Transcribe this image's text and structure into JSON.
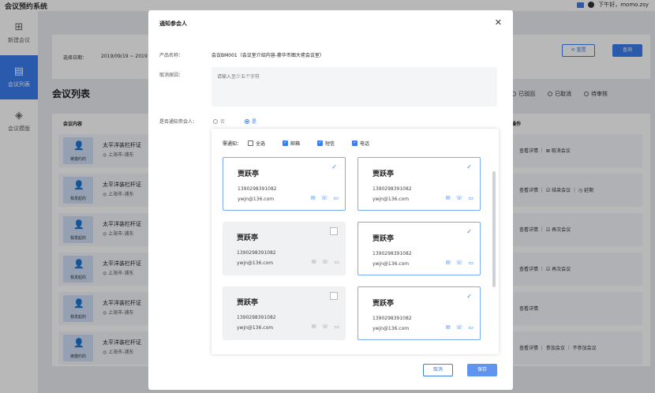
{
  "app": {
    "title": "会议预约系统",
    "greeting": "下午好，momo.zsy"
  },
  "sidebar": {
    "items": [
      {
        "label": "新建会议",
        "icon": "add-file-icon",
        "active": false
      },
      {
        "label": "会议列表",
        "icon": "list-icon",
        "active": true
      },
      {
        "label": "会议模版",
        "icon": "layers-icon",
        "active": false
      }
    ]
  },
  "filter": {
    "date_label": "选择日期：",
    "date_value": "2019/09/19 ~ 2019",
    "reset_label": "⟲ 重置",
    "query_label": "查询"
  },
  "list": {
    "title": "会议列表",
    "status_tabs": [
      "已驳回",
      "已取消",
      "待审核"
    ],
    "col_content": "会议内容",
    "col_action": "操作",
    "rows": [
      {
        "tag": "被邀约的",
        "title": "太平洋装栏杆证",
        "addr": "上海市-浦东",
        "actions": "查看详情 ｜ ⊠ 取消会议"
      },
      {
        "tag": "我发起的",
        "title": "太平洋装栏杆证",
        "addr": "上海市-浦东",
        "actions": "查看详情 ｜ ☑ 结束会议 ｜ ◷ 延期"
      },
      {
        "tag": "我发起的",
        "title": "太平洋装栏杆证",
        "addr": "上海市-浦东",
        "actions": "查看详情 ｜ ☑ 再次会议"
      },
      {
        "tag": "我发起的",
        "title": "太平洋装栏杆证",
        "addr": "上海市-浦东",
        "actions": "查看详情 ｜ ☑ 再次会议"
      },
      {
        "tag": "我发起的",
        "title": "太平洋装栏杆证",
        "addr": "上海市-浦东",
        "actions": "查看详情"
      },
      {
        "tag": "被邀约的",
        "title": "太平洋装栏杆证",
        "addr": "上海市-浦东",
        "actions": "查看详情 ｜ 参加会议 ｜ 不参加会议"
      }
    ]
  },
  "modal": {
    "title": "通知参会人",
    "product_label": "产品名称：",
    "product_value": "会议BM001（会议室介绍内容-豪华币图大佬会议室）",
    "reason_label": "取消原因：",
    "reason_placeholder": "请输入至少五个字符",
    "notify_label": "是否通知参会人：",
    "opt_no": "否",
    "opt_yes": "是",
    "channel_label": "需通知：",
    "channels": [
      {
        "label": "全选",
        "checked": false
      },
      {
        "label": "邮箱",
        "checked": true
      },
      {
        "label": "短信",
        "checked": true
      },
      {
        "label": "电话",
        "checked": true
      }
    ],
    "contacts": [
      {
        "name": "贾跃亭",
        "phone": "1390298391082",
        "email": "ywjn@136.com",
        "selected": true
      },
      {
        "name": "贾跃亭",
        "phone": "1390298391082",
        "email": "ywjn@136.com",
        "selected": true
      },
      {
        "name": "贾跃亭",
        "phone": "1390298391082",
        "email": "ywjn@136.com",
        "selected": false
      },
      {
        "name": "贾跃亭",
        "phone": "1390298391082",
        "email": "ywjn@136.com",
        "selected": true
      },
      {
        "name": "贾跃亭",
        "phone": "1390298391082",
        "email": "ywjn@136.com",
        "selected": false
      },
      {
        "name": "贾跃亭",
        "phone": "1390298391082",
        "email": "ywjn@136.com",
        "selected": true
      }
    ],
    "cancel_label": "取消",
    "save_label": "保存"
  },
  "colors": {
    "accent": "#3b7ded"
  }
}
